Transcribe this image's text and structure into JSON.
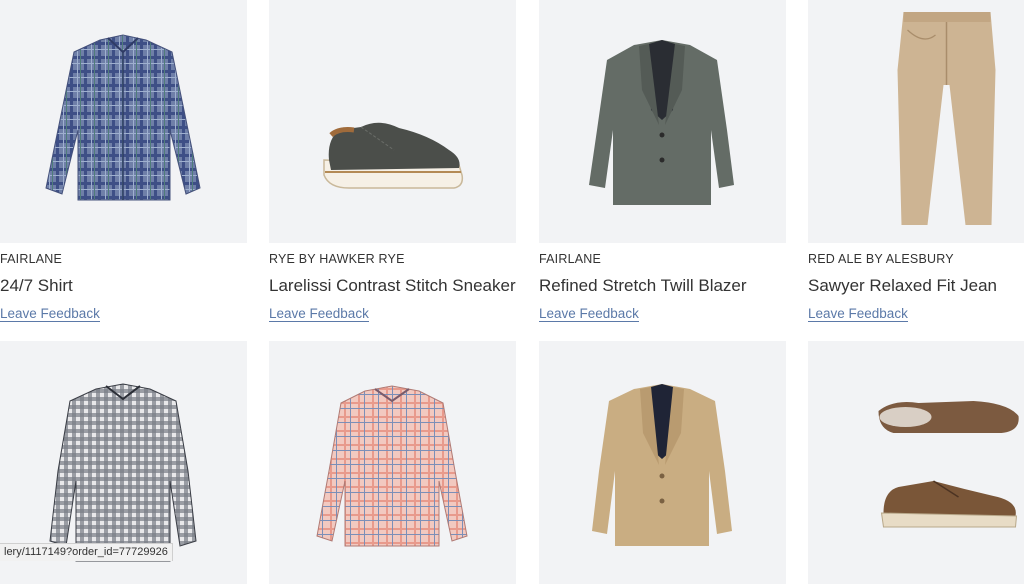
{
  "items": [
    {
      "brand": "FAIRLANE",
      "title": "24/7 Shirt",
      "feedback": "Leave Feedback",
      "image": "blue-plaid-shirt"
    },
    {
      "brand": "RYE BY HAWKER RYE",
      "title": "Larelissi Contrast Stitch Sneaker",
      "feedback": "Leave Feedback",
      "image": "grey-sneaker"
    },
    {
      "brand": "FAIRLANE",
      "title": "Refined Stretch Twill Blazer",
      "feedback": "Leave Feedback",
      "image": "grey-blazer"
    },
    {
      "brand": "RED ALE BY ALESBURY",
      "title": "Sawyer Relaxed Fit Jean",
      "feedback": "Leave Feedback",
      "image": "khaki-jeans"
    },
    {
      "image": "black-gingham-shirt"
    },
    {
      "image": "pink-plaid-shirt"
    },
    {
      "image": "tan-blazer"
    },
    {
      "image": "brown-shoes"
    }
  ],
  "status_bar": {
    "url": "lery/1117149?order_id=77729926"
  },
  "colors": {
    "link": "#5b79a8",
    "tile_background": "#f2f3f5"
  }
}
